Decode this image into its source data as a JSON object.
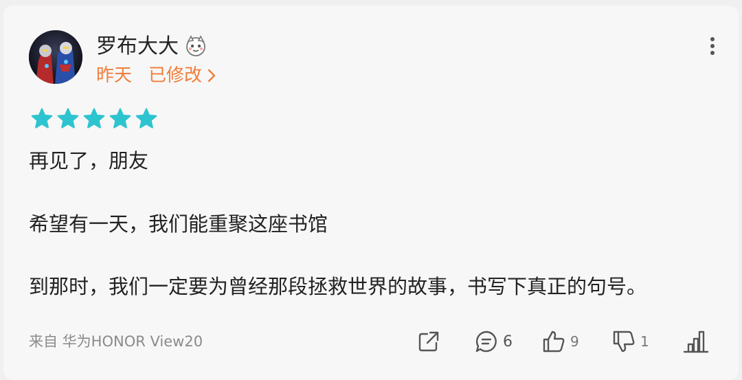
{
  "review": {
    "username": "罗布大大",
    "time": "昨天",
    "edited_label": "已修改",
    "rating": 5,
    "rating_max": 5,
    "star_color": "#2ec4cf",
    "accent_color": "#f07d3a",
    "content_lines": [
      "再见了，朋友",
      "希望有一天，我们能重聚这座书馆",
      "到那时，我们一定要为曾经那段拯救世界的故事，书写下真正的句号。"
    ],
    "source": "来自 华为HONOR View20"
  },
  "actions": {
    "share_icon": "share-icon",
    "comment_count": "6",
    "like_count": "9",
    "dislike_count": "1",
    "stats_icon": "stats-icon"
  }
}
